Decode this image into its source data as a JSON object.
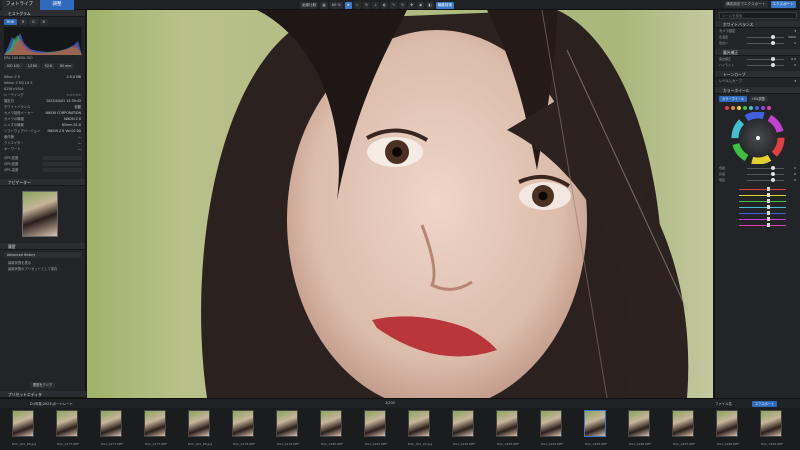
{
  "app": {
    "tab_library": "フォトライブラリ",
    "tab_customize": "調整"
  },
  "toolbar": {
    "compare": "画像比較",
    "zoom": "60 %",
    "view_mode": "編集前後"
  },
  "right_top": {
    "export_label": "構成設定でエクスポート",
    "export": "エクスポート"
  },
  "left": {
    "histogram": "ヒストグラム",
    "hist_tags": [
      "RGB",
      "R",
      "G",
      "B"
    ],
    "hist_footer": "DRL 100 HDL ISO",
    "exif_row": [
      "ISO 100",
      "1/160",
      "f/2.8",
      "85 mm"
    ],
    "info_rows": [
      {
        "k": "Nikon Z 8",
        "v": "2.8.0 MB"
      },
      {
        "k": "Nikkor Z 85/1.8 S",
        "v": ""
      },
      {
        "k": "8256×5504",
        "v": ""
      },
      {
        "k": "レーティング",
        "v": "☆☆☆☆☆"
      },
      {
        "k": "撮影日",
        "v": "2023/04/01 15:39:43"
      },
      {
        "k": "ホワイトバランス",
        "v": "自動"
      },
      {
        "k": "カメラ製造メーカー",
        "v": "NIKON CORPORATION"
      },
      {
        "k": "カメラの機種",
        "v": "NIKON Z 8"
      },
      {
        "k": "レンズの機種",
        "v": "85mm f/1.8"
      },
      {
        "k": "ソフトウェアバージョン",
        "v": "NIKON Z 8 Ver.02.00"
      },
      {
        "k": "著作権",
        "v": "—"
      },
      {
        "k": "クリエイター",
        "v": "—"
      },
      {
        "k": "キーワード",
        "v": "—"
      }
    ],
    "gps_rows": [
      "GPS 緯度",
      "GPS 経度",
      "GPS 高度"
    ],
    "nav_title": "ナビゲーター",
    "history_title": "履歴",
    "history_items": [
      "Advanced History",
      "最新状態を表示",
      "最新状態のプリセットとして保存"
    ],
    "preset_title": "プリセットエディタ",
    "clear_btn": "履歴をクリア"
  },
  "right": {
    "search_placeholder": "ツールを検索",
    "section_wb": "ホワイトバランス",
    "wb_preset_label": "カメラ設定",
    "wb_sliders": [
      {
        "name": "色温度",
        "val": "5000"
      },
      {
        "name": "色合い",
        "val": "0"
      }
    ],
    "section_exposure": "露光補正",
    "exp_sliders": [
      {
        "name": "露出補正",
        "val": "0.0"
      },
      {
        "name": "ハイライト",
        "val": "0"
      }
    ],
    "section_tone": "トーンカーブ",
    "tone_label": "レベルとカーブ",
    "section_color": "カラーホイール",
    "color_btn": "カラーホイール",
    "hsl_btn": "HSL調整",
    "hsl_sliders": [
      {
        "name": "色相",
        "val": "0"
      },
      {
        "name": "彩度",
        "val": "0"
      },
      {
        "name": "明度",
        "val": "0"
      }
    ]
  },
  "filmbar": {
    "path": "D:\\写真\\2023\\ポートレート",
    "count": "1/200",
    "sort": "ファイル名",
    "export_btn": "エクスポート"
  },
  "film": [
    "DSC_001_88.jpg",
    "DSC_0177.NEF",
    "DSC_0177.NEF",
    "DSC_0177.NEF",
    "DSC_001_88.jpg",
    "DSC_0178.NEF",
    "DSC_0179.NEF",
    "DSC_0180.NEF",
    "DSC_0181.NEF",
    "DSC_001_90.jpg",
    "DSC_0182.NEF",
    "DSC_0183.NEF",
    "DSC_0184.NEF",
    "DSC_0185.NEF",
    "DSC_0186.NEF",
    "DSC_0187.NEF",
    "DSC_0188.NEF",
    "DSC_0189.NEF"
  ],
  "colors": {
    "accent": "#2f6bbd",
    "panel": "#232427",
    "bg": "#1a1b1d"
  }
}
